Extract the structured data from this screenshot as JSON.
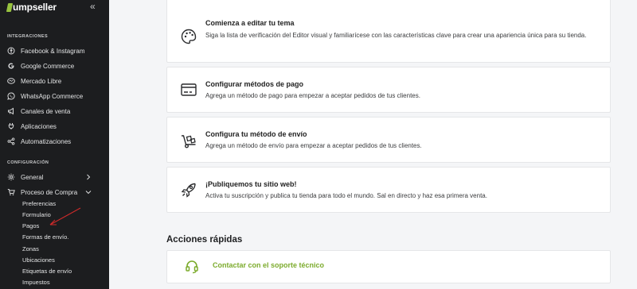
{
  "brand": {
    "name": "umpseller",
    "collapse_icon": "double-chevron-left-icon"
  },
  "sidebar": {
    "sections": [
      {
        "title": "INTEGRACIONES",
        "items": [
          {
            "label": "Facebook & Instagram",
            "icon": "facebook-instagram-icon"
          },
          {
            "label": "Google Commerce",
            "icon": "google-icon"
          },
          {
            "label": "Mercado Libre",
            "icon": "handshake-icon"
          },
          {
            "label": "WhatsApp Commerce",
            "icon": "whatsapp-icon"
          },
          {
            "label": "Canales de venta",
            "icon": "megaphone-icon"
          },
          {
            "label": "Aplicaciones",
            "icon": "plug-icon"
          },
          {
            "label": "Automatizaciones",
            "icon": "share-nodes-icon"
          }
        ]
      },
      {
        "title": "CONFIGURACIÓN",
        "items": [
          {
            "label": "General",
            "icon": "gear-icon",
            "expanded": false
          },
          {
            "label": "Proceso de Compra",
            "icon": "cart-icon",
            "expanded": true
          }
        ]
      }
    ],
    "sub_items": [
      "Preferencias",
      "Formulario",
      "Pagos",
      "Formas de envío.",
      "Zonas",
      "Ubicaciones",
      "Etiquetas de envío",
      "Impuestos"
    ]
  },
  "cards": [
    {
      "title": "Comienza a editar tu tema",
      "description": "Siga la lista de verificación del Editor visual y familiarícese con las características clave para crear una apariencia única para su tienda.",
      "icon": "palette-icon"
    },
    {
      "title": "Configurar métodos de pago",
      "description": "Agrega un método de pago para empezar a aceptar pedidos de tus clientes.",
      "icon": "credit-card-icon"
    },
    {
      "title": "Configura tu método de envío",
      "description": "Agrega un método de envío para empezar a aceptar pedidos de tus clientes.",
      "icon": "dolly-icon"
    },
    {
      "title": "¡Publiquemos tu sitio web!",
      "description": "Activa tu suscripción y publica tu tienda para todo el mundo. Sal en directo y haz esa primera venta.",
      "icon": "rocket-icon"
    }
  ],
  "quick_actions": {
    "heading": "Acciones rápidas",
    "support_label": "Contactar con el soporte técnico",
    "support_icon": "headset-icon"
  },
  "colors": {
    "sidebar_bg": "#1c1d1f",
    "accent_green": "#7cab2c",
    "page_bg": "#f4f5f7",
    "annotation_red": "#d12a2a"
  }
}
